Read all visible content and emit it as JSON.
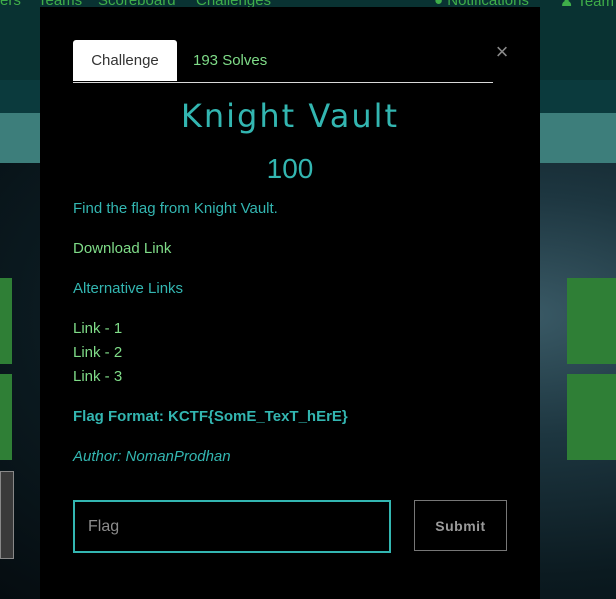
{
  "nav": {
    "items": [
      "ers",
      "Teams",
      "Scoreboard",
      "Challenges"
    ],
    "notifications": "Notifications",
    "team": "Team"
  },
  "modal": {
    "tabs": [
      {
        "label": "Challenge",
        "active": true
      },
      {
        "label": "193 Solves",
        "active": false
      }
    ],
    "close_symbol": "×",
    "title": "Knight Vault",
    "value": "100",
    "description": "Find the flag from Knight Vault.",
    "download_link": "Download Link",
    "alternative_links_heading": "Alternative Links",
    "links": [
      "Link - 1",
      "Link - 2",
      "Link - 3"
    ],
    "flag_format": "Flag Format: KCTF{SomE_TexT_hErE}",
    "author": "Author: NomanProdhan",
    "flag_placeholder": "Flag",
    "flag_value": "",
    "submit_label": "Submit"
  },
  "colors": {
    "accent_teal": "#33b6b1",
    "link_green": "#7fdc88",
    "nav_green": "#3fae49",
    "modal_bg": "#000000"
  }
}
